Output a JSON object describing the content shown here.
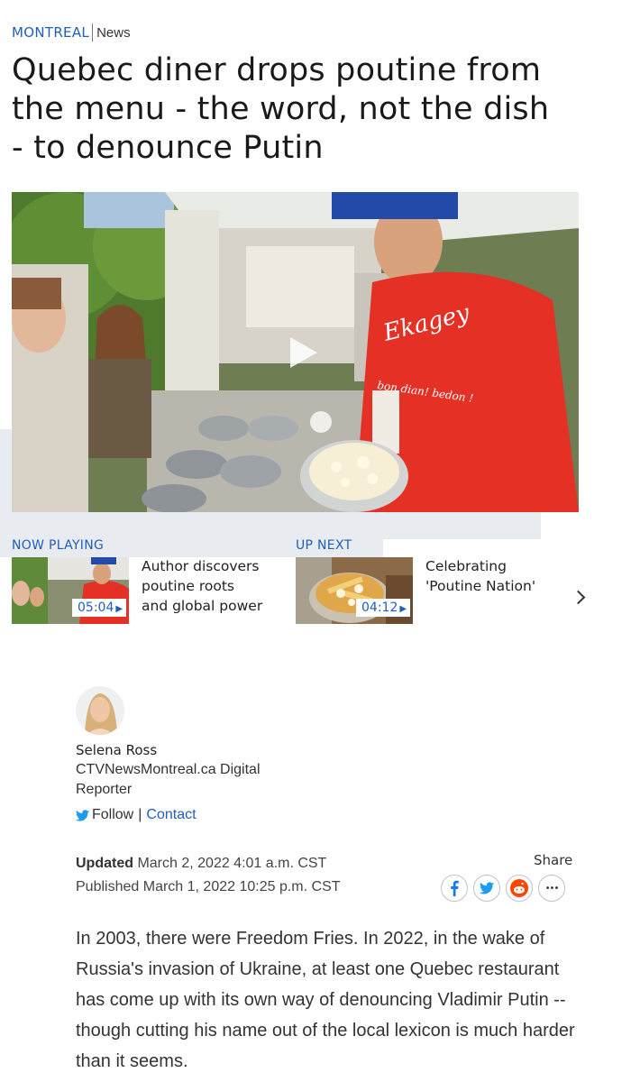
{
  "breadcrumb": {
    "section": "MONTREAL",
    "subsection": "News"
  },
  "headline": "Quebec diner drops poutine from the menu - the word, not the dish - to denounce Putin",
  "hero": {
    "shirt_text": "Ekagey",
    "shirt_subtext": "bon dian! bedon !"
  },
  "videos": {
    "now_playing": {
      "label": "NOW PLAYING",
      "duration": "05:04",
      "title": "Author discovers poutine roots and global power"
    },
    "up_next": {
      "label": "UP NEXT",
      "duration": "04:12",
      "title": "Celebrating 'Poutine Nation'"
    }
  },
  "author": {
    "name": "Selena Ross",
    "role": "CTVNewsMontreal.ca Digital Reporter",
    "follow_label": "Follow",
    "separator": "|",
    "contact_label": "Contact"
  },
  "dates": {
    "updated_label": "Updated",
    "updated_value": "March 2, 2022 4:01 a.m. CST",
    "published_label": "Published",
    "published_value": "March 1, 2022 10:25 p.m. CST"
  },
  "share": {
    "label": "Share",
    "icons": [
      "facebook-icon",
      "twitter-icon",
      "reddit-icon",
      "more-icon"
    ],
    "more_glyph": "•••"
  },
  "article": {
    "lead": "In 2003, there were Freedom Fries. In 2022, in the wake of Russia's invasion of Ukraine, at least one Quebec restaurant has come up with its own way of denouncing Vladimir Putin -- though cutting his name out of the local lexicon is much harder than it seems."
  },
  "colors": {
    "accent": "#1f5fb8",
    "twitter": "#1d9bf0",
    "facebook": "#1877f2",
    "reddit": "#ff4500",
    "band": "#e8ebef"
  }
}
